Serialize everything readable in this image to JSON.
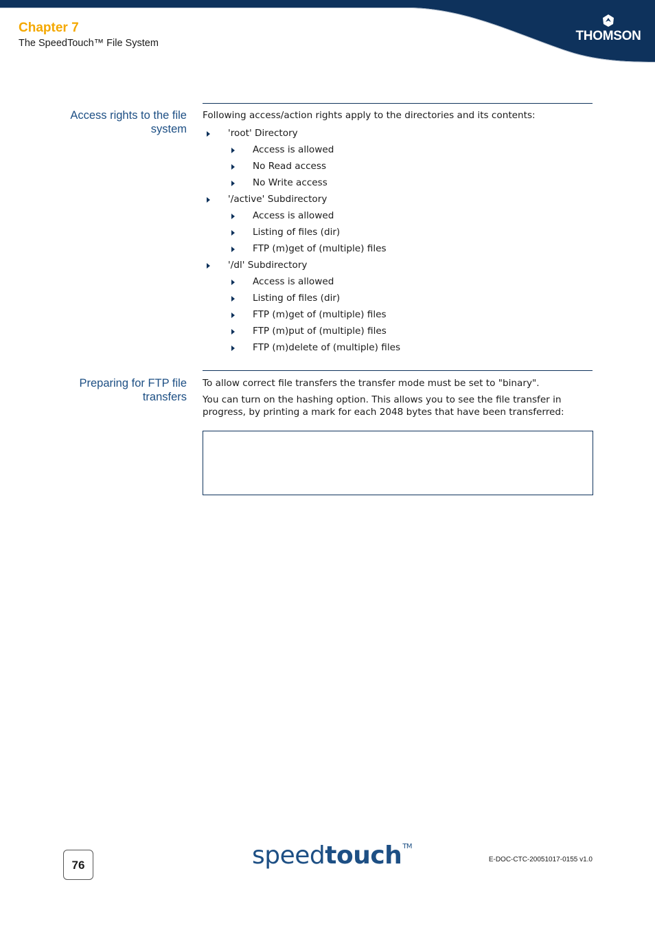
{
  "header": {
    "chapter": "Chapter 7",
    "subtitle": "The SpeedTouch™ File System",
    "brand_logo": "THOMSON",
    "brand_color": "#0e325c",
    "accent_color": "#f4a800"
  },
  "sections": [
    {
      "heading": "Access rights to the file system",
      "intro": "Following access/action rights apply to the directories and its contents:",
      "list": [
        {
          "level": 1,
          "text": "'root' Directory"
        },
        {
          "level": 2,
          "text": "Access is allowed"
        },
        {
          "level": 2,
          "text": "No Read access"
        },
        {
          "level": 2,
          "text": "No Write access"
        },
        {
          "level": 1,
          "text": "'/active' Subdirectory"
        },
        {
          "level": 2,
          "text": "Access is allowed"
        },
        {
          "level": 2,
          "text": "Listing of files (dir)"
        },
        {
          "level": 2,
          "text": "FTP (m)get of (multiple) files"
        },
        {
          "level": 1,
          "text": "'/dl' Subdirectory"
        },
        {
          "level": 2,
          "text": "Access is allowed"
        },
        {
          "level": 2,
          "text": "Listing of files (dir)"
        },
        {
          "level": 2,
          "text": "FTP (m)get of (multiple) files"
        },
        {
          "level": 2,
          "text": "FTP (m)put of (multiple) files"
        },
        {
          "level": 2,
          "text": "FTP (m)delete of (multiple) files"
        }
      ]
    },
    {
      "heading": "Preparing for FTP file transfers",
      "paragraphs": [
        "To allow correct file transfers the transfer mode must be set to \"binary\".",
        "You can turn on the hashing option. This allows you to see the file transfer in progress, by printing a mark for each 2048 bytes that have been transferred:"
      ],
      "code_box": ""
    }
  ],
  "footer": {
    "page_number": "76",
    "logo_light": "speed",
    "logo_bold": "touch",
    "logo_tm": "TM",
    "doc_id": "E-DOC-CTC-20051017-0155 v1.0"
  }
}
